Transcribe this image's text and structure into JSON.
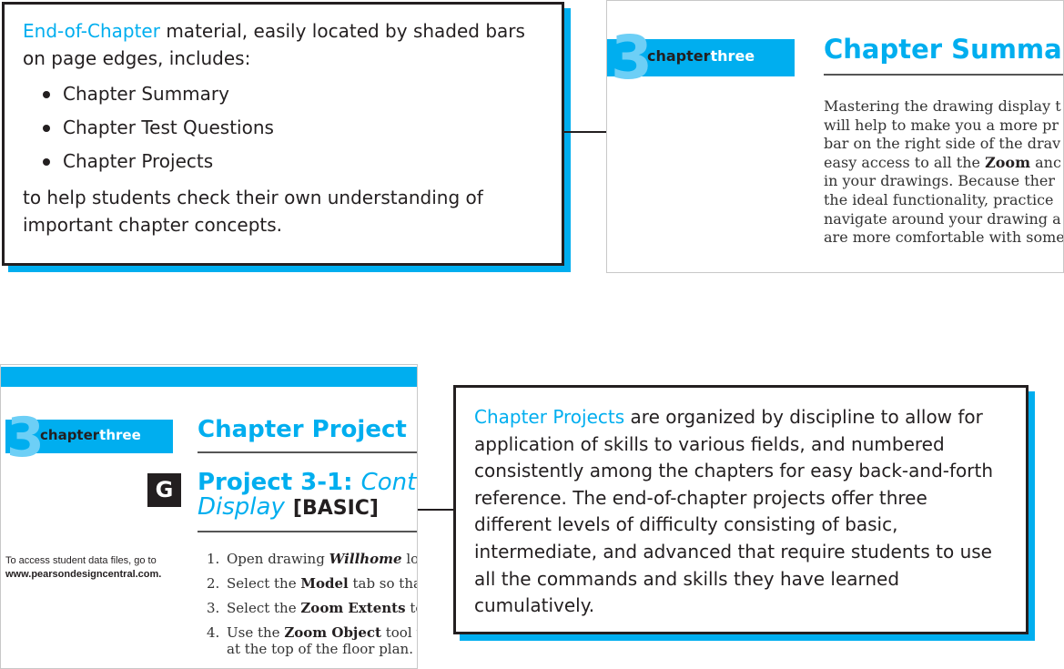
{
  "callout_top": {
    "highlight": "End-of-Chapter",
    "intro_rest": " material, easily located by shaded bars on page edges, includes:",
    "items": [
      "Chapter Summary",
      "Chapter Test Questions",
      "Chapter Projects"
    ],
    "outro": "to help students check their own understanding of important chapter concepts."
  },
  "summary_page": {
    "chapter_number": "3",
    "chapter_word": "chapter",
    "chapter_name": "three",
    "title": "Chapter Summary",
    "body_lines": [
      [
        "Mastering the drawing display t",
        "",
        ""
      ],
      [
        "will help to make you a more pr",
        "",
        ""
      ],
      [
        "bar on the right side of the drav",
        "",
        ""
      ],
      [
        "easy access to all the ",
        "Zoom",
        " anc"
      ],
      [
        "in your drawings. Because ther",
        "",
        ""
      ],
      [
        "the ideal functionality, practice",
        "",
        ""
      ],
      [
        "navigate around your drawing a",
        "",
        ""
      ],
      [
        "are more comfortable with some",
        "",
        ""
      ]
    ]
  },
  "project_page": {
    "chapter_number": "3",
    "chapter_word": "chapter",
    "chapter_name": "three",
    "title": "Chapter Project",
    "badge": "G",
    "project_label": "Project 3-1: ",
    "project_name_1": "Control",
    "project_name_2": "Display",
    "level": "[BASIC]",
    "note_line1": "To access student data files, go to",
    "note_line2": "www.pearsondesigncentral.com.",
    "steps": [
      {
        "num": "1.",
        "pre": "Open drawing ",
        "bold": "Willhome",
        "post": " loc",
        "italic": true
      },
      {
        "num": "2.",
        "pre": "Select the ",
        "bold": "Model",
        "post": " tab so that"
      },
      {
        "num": "3.",
        "pre": "Select the ",
        "bold": "Zoom Extents",
        "post": " to"
      },
      {
        "num": "4.",
        "pre": "Use the ",
        "bold": "Zoom Object",
        "post": " tool to",
        "line2": "at the top of the floor plan."
      }
    ]
  },
  "callout_bottom": {
    "highlight": "Chapter Projects",
    "rest": " are organized by discipline to allow for application of skills to various fields, and numbered consistently among the chapters for easy back-and-forth reference. The end-of-chapter projects offer three different levels of difficulty consisting of basic, intermediate, and advanced that require students to use all the commands and skills they have learned cumulatively."
  },
  "colors": {
    "accent": "#00aeef",
    "accent_light": "#6dcff6",
    "text": "#231f20"
  }
}
